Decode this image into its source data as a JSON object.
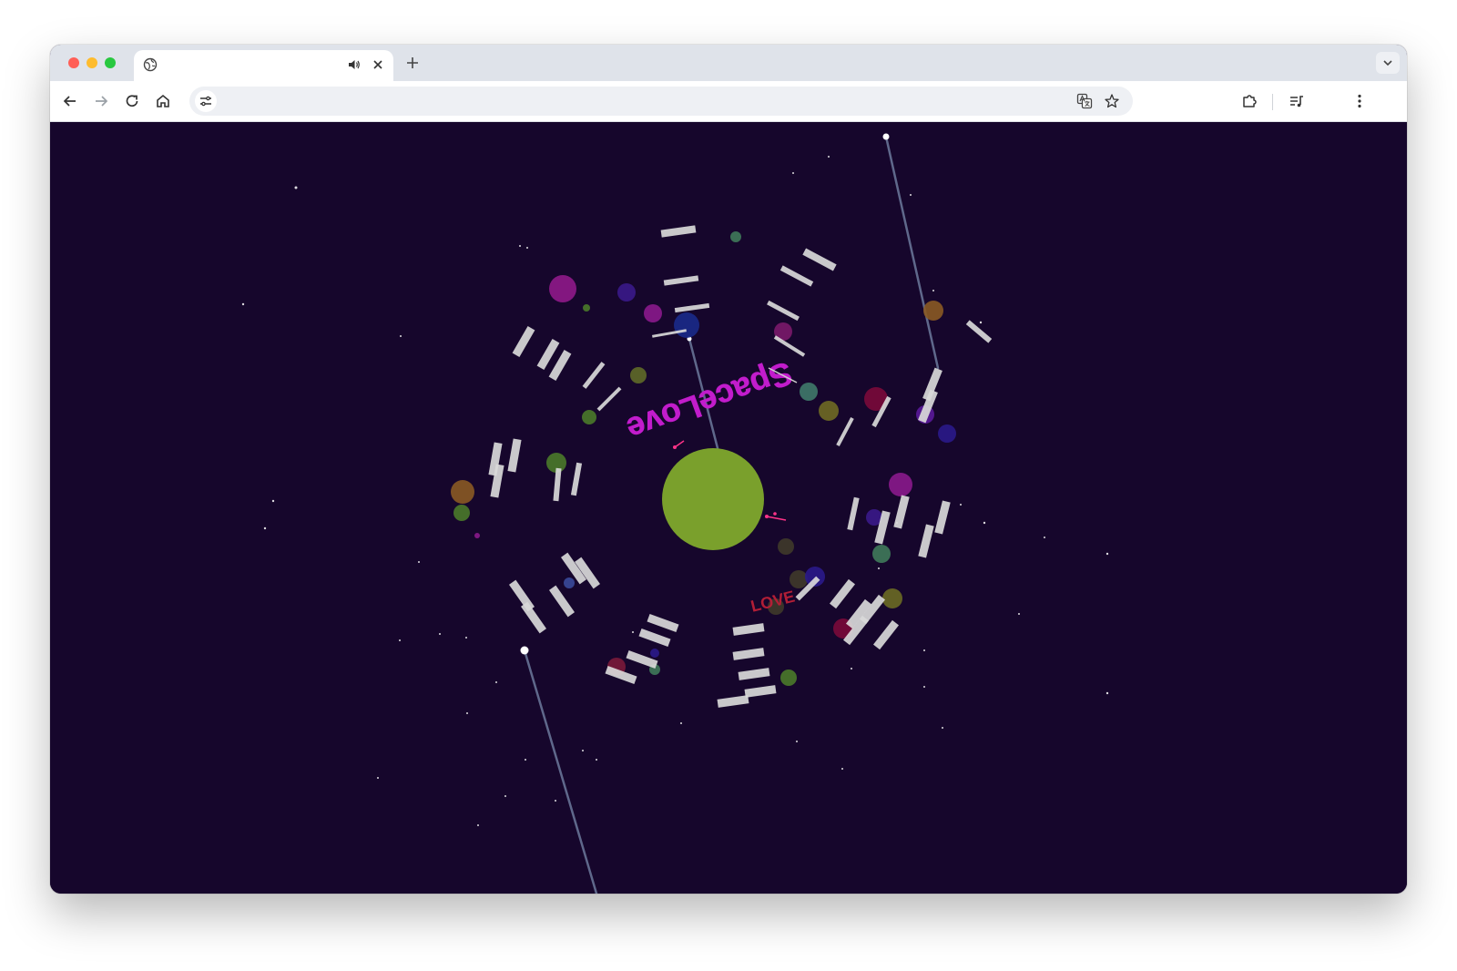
{
  "browser": {
    "tab": {
      "title": "",
      "favicon": "globe-icon",
      "audio_icon": "speaker-icon",
      "close_icon": "close-icon"
    },
    "new_tab_icon": "plus-icon",
    "tab_list_icon": "chevron-down-icon",
    "nav": {
      "back_icon": "arrow-left-icon",
      "forward_icon": "arrow-right-icon",
      "reload_icon": "reload-icon",
      "home_icon": "home-icon"
    },
    "omnibox": {
      "url": "",
      "site_info_icon": "tune-icon",
      "translate_icon": "translate-icon",
      "bookmark_icon": "star-icon"
    },
    "extensions_icon": "puzzle-icon",
    "media_icon": "queue-music-icon",
    "menu_icon": "kebab-menu-icon"
  },
  "scene": {
    "background_color": "#16062c",
    "planet_color": "#7aa02c",
    "heading_text": "SpaceLove",
    "heading_color": "#c21ccc",
    "small_text": "LOVE",
    "small_text_color": "#b21e36",
    "panel_color": "#d9d9d9",
    "comet_color": "#6c7a9c"
  }
}
